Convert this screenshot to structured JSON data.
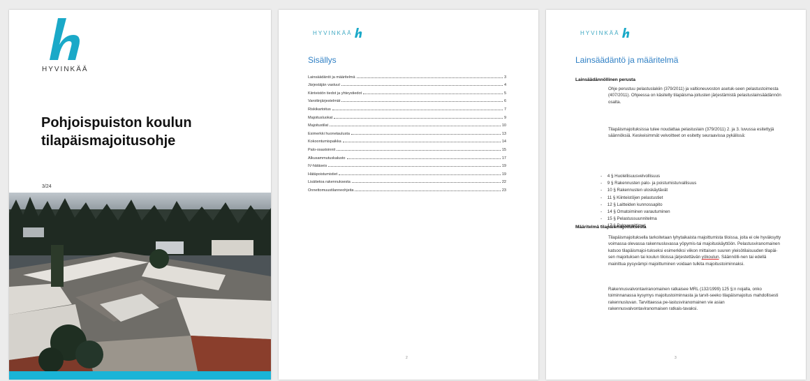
{
  "cover": {
    "brand": "HYVINKÄÄ",
    "title_line1": "Pohjoispuiston koulun",
    "title_line2": "tilapäismajoitusohje",
    "subtitle": "3/24"
  },
  "toc_page": {
    "header_brand": "HYVINKÄÄ",
    "title": "Sisällys",
    "entries": [
      {
        "label": "Lainsäädäntö ja määritelmä",
        "page": "3"
      },
      {
        "label": "Järjestäjän vastuut",
        "page": "4"
      },
      {
        "label": "Kiinteistön tiedot ja yhteystiedot",
        "page": "5"
      },
      {
        "label": "Varoitinjärjestelmät",
        "page": "6"
      },
      {
        "label": "Riskikartoitus",
        "page": "7"
      },
      {
        "label": "Majoitusluokat",
        "page": "9"
      },
      {
        "label": "Majoitustilat",
        "page": "10"
      },
      {
        "label": "Esimerkki huonetaulusta",
        "page": "13"
      },
      {
        "label": "Kokoontumispaikka",
        "page": "14"
      },
      {
        "label": "Palo-osastoinnit",
        "page": "15"
      },
      {
        "label": "Alkusammutuskalusto",
        "page": "17"
      },
      {
        "label": "IV-hätäseis",
        "page": "19"
      },
      {
        "label": "Hätäpoistumistiet",
        "page": "19"
      },
      {
        "label": "Lisätietoa rakennuksesta",
        "page": "22"
      },
      {
        "label": "Onnettomuustilanneohjeita",
        "page": "23"
      }
    ],
    "page_number": "2"
  },
  "law_page": {
    "header_brand": "HYVINKÄÄ",
    "title": "Lainsäädäntö ja määritelmä",
    "section1_heading": "Lainsäädännöllinen perusta",
    "section1_p1": "Ohje perustuu pelastuslakiin (379/2011) ja valtioneuvoston asetuk-seen pelastustoimesta (407/2011). Ohjeessa on käsitelty tilapäisma-joitusten järjestämistä pelastuslainsäädännön osalta.",
    "section1_p2": "Tilapäismajoituksissa tulee noudattaa pelastuslain (379/2011) 2. ja 3. luvussa esitettyjä säännöksiä. Keskeisimmät velvoitteet on esitetty seuraavissa pykälissä:",
    "list": [
      "4 § Huolellisuusvelvollisuus",
      "9 § Rakennusten palo- ja poistumisturvallisuus",
      "10 § Rakennusten uloskäytävät",
      "11 § Kiinteistöjen pelastustiet",
      "12 § Laitteiden kunnossapito",
      "14 § Omatoiminen varautuminen",
      "15 § Pelastussuunnitelma",
      "17 § Palovaroittimet"
    ],
    "section2_heading": "Määritelmä tilapäismajoituksesta",
    "section2_p1_a": "Tilapäismajoituksella tarkoitetaan lyhytaikaista majoittumista tiloissa, joita ei ole hyväksytty voimassa olevassa rakennusluvassa yöpymis-tai majoituskäyttöön. Pelastusviranomainen katsoo tilapäismajoi-tukseksi esimerkiksi viikon mittaisen suuren yleisötilaisuuden tilapäi-sen majoituksen tai koulun tiloissa järjestettävän ",
    "section2_p1_u": "yökoulun",
    "section2_p1_b": ". Säännölli-nen tai edellä mainittua pysyvämpi majoittuminen voidaan tulkita majoitustoiminnaksi.",
    "section2_p2": "Rakennusvalvontaviranomainen ratkaisee MRL (132/1999) 125 §:n nojalla, onko toiminnanassa kysymys majoitustoiminnasta ja tarvit-seeko tilapäismajoitus mahdollisesti rakennusluvan. Tarvittaessa pe-lastusviranomainen vie asian rakennusvalvontaviranomaisen ratkais-tavaksi.",
    "page_number": "3"
  }
}
